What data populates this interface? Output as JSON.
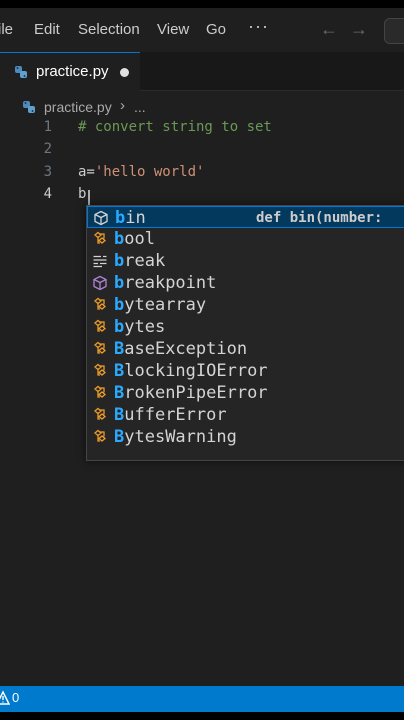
{
  "menu": {
    "file": "ile",
    "edit": "Edit",
    "selection": "Selection",
    "view": "View",
    "go": "Go",
    "more": "···"
  },
  "tab": {
    "label": "practice.py",
    "modified": true
  },
  "breadcrumb": {
    "file": "practice.py",
    "separator": "›",
    "more": "..."
  },
  "editor": {
    "lines": [
      {
        "num": "1",
        "text": "# convert string to set"
      },
      {
        "num": "2",
        "text": ""
      },
      {
        "num": "3",
        "var": "a=",
        "str": "'hello world'"
      },
      {
        "num": "4",
        "text": "b"
      }
    ]
  },
  "suggest": {
    "typed": "b",
    "items": [
      {
        "icon": "function-cube-icon",
        "rest": "in",
        "detail": "def bin(number:"
      },
      {
        "icon": "class-icon",
        "rest": "ool"
      },
      {
        "icon": "keyword-icon",
        "rest": "reak"
      },
      {
        "icon": "function-cube-icon",
        "rest": "reakpoint"
      },
      {
        "icon": "class-icon",
        "rest": "ytearray"
      },
      {
        "icon": "class-icon",
        "rest": "ytes"
      },
      {
        "icon": "class-icon",
        "first": "B",
        "rest": "aseException"
      },
      {
        "icon": "class-icon",
        "first": "B",
        "rest": "lockingIOError"
      },
      {
        "icon": "class-icon",
        "first": "B",
        "rest": "rokenPipeError"
      },
      {
        "icon": "class-icon",
        "first": "B",
        "rest": "ufferError"
      },
      {
        "icon": "class-icon",
        "first": "B",
        "rest": "ytesWarning"
      }
    ]
  },
  "status": {
    "warnings": "0"
  },
  "colors": {
    "accent": "#0078d4",
    "statusbar": "#007acc",
    "match": "#2aaaff",
    "class_icon": "#ee9d28",
    "function_icon": "#b180d7"
  }
}
